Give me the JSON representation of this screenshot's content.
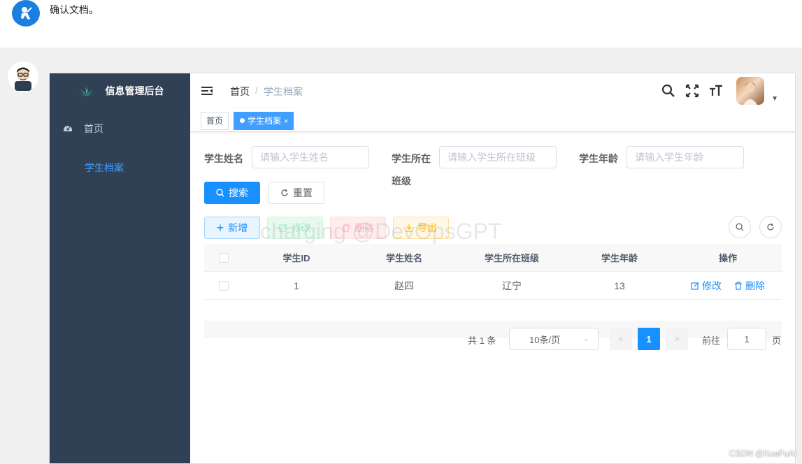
{
  "chat": {
    "message": "确认文档。"
  },
  "sidebar": {
    "logo_title": "信息管理后台",
    "items": [
      {
        "label": "首页",
        "icon": "dashboard-icon"
      },
      {
        "label": "学生档案"
      }
    ]
  },
  "navbar": {
    "breadcrumb_home": "首页",
    "breadcrumb_sep": "/",
    "breadcrumb_current": "学生档案"
  },
  "tags": {
    "home": "首页",
    "active": "学生档案",
    "close_glyph": "×"
  },
  "form": {
    "name_label": "学生姓名",
    "name_placeholder": "请输入学生姓名",
    "class_label_line1": "学生所在",
    "class_label_line2": "班级",
    "class_placeholder": "请输入学生所在班级",
    "age_label": "学生年龄",
    "age_placeholder": "请输入学生年龄",
    "search_btn": "搜索",
    "reset_btn": "重置"
  },
  "toolbar": {
    "add": "新增",
    "edit": "修改",
    "delete": "删除",
    "export": "导出"
  },
  "watermark": "charging @DevOpsGPT",
  "table": {
    "headers": [
      "学生ID",
      "学生姓名",
      "学生所在班级",
      "学生年龄",
      "操作"
    ],
    "rows": [
      {
        "id": "1",
        "name": "赵四",
        "class": "辽宁",
        "age": "13",
        "edit": "修改",
        "delete": "删除"
      }
    ]
  },
  "pagination": {
    "total": "共 1 条",
    "page_size": "10条/页",
    "current_page": "1",
    "goto_label": "前往",
    "goto_value": "1",
    "page_suffix": "页"
  },
  "footer": {
    "credit": "CSDN @KuaFuAI"
  },
  "colors": {
    "primary": "#1890ff",
    "sidebar_bg": "#304156",
    "menu_active": "#409eff"
  }
}
